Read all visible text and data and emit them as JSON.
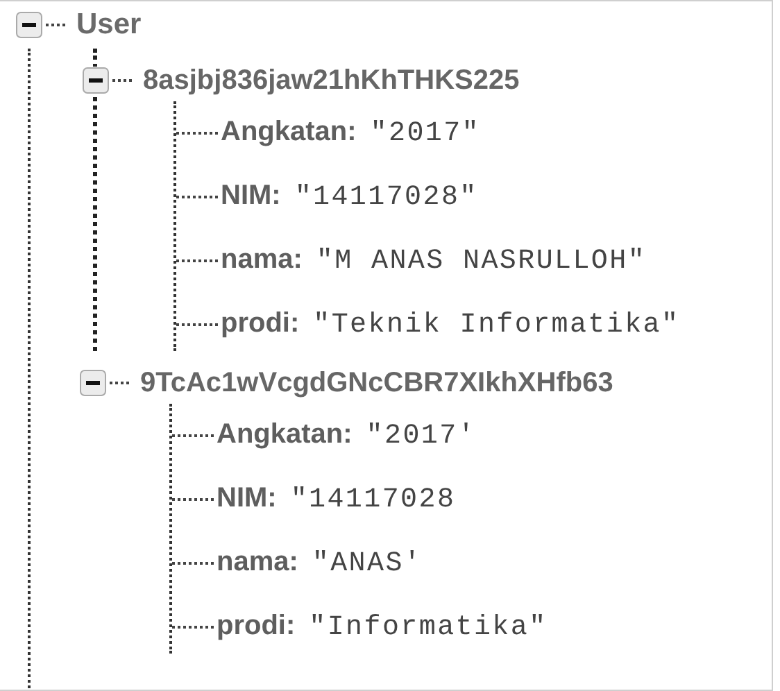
{
  "tree": {
    "key": "User",
    "expanded": true,
    "children": [
      {
        "key": "8asjbj836jaw21hKhTHKS225",
        "expanded": true,
        "children": [
          {
            "key": "Angkatan:",
            "value": "\"2017\""
          },
          {
            "key": "NIM:",
            "value": "\"14117028\""
          },
          {
            "key": "nama:",
            "value": "\"M ANAS NASRULLOH\""
          },
          {
            "key": "prodi:",
            "value": "\"Teknik Informatika\""
          }
        ]
      },
      {
        "key": "9TcAc1wVcgdGNcCBR7XIkhXHfb63",
        "expanded": true,
        "children": [
          {
            "key": "Angkatan:",
            "value": "\"2017'"
          },
          {
            "key": "NIM:",
            "value": "\"14117028"
          },
          {
            "key": "nama:",
            "value": "\"ANAS'"
          },
          {
            "key": "prodi:",
            "value": "\"Informatika\""
          }
        ]
      }
    ]
  }
}
